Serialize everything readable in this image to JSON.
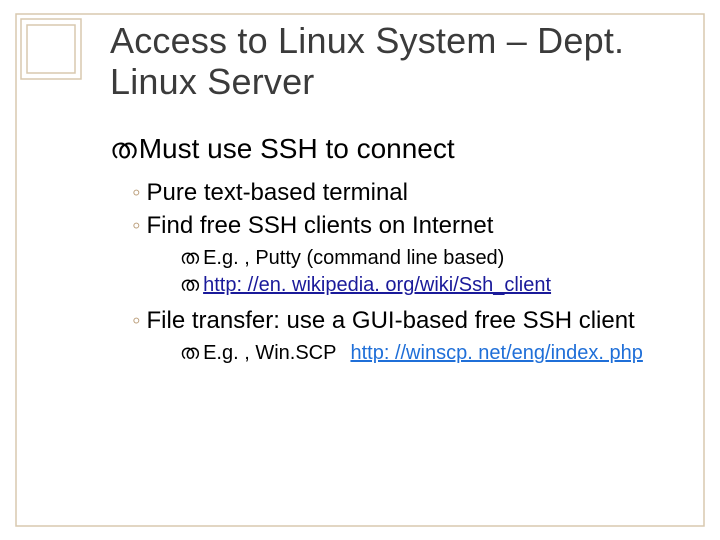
{
  "title": "Access to Linux System – Dept. Linux Server",
  "main": {
    "text": "Must use SSH to connect"
  },
  "sub": {
    "s1": "Pure text-based terminal",
    "s2": "Find free SSH clients on Internet",
    "s2a": "E.g. , Putty  (command line based)",
    "s2b": "http: //en. wikipedia. org/wiki/Ssh_client",
    "s3": "File transfer: use a GUI-based free SSH client",
    "s3a_prefix": "E.g. , Win.SCP",
    "s3a_link": "http: //winscp. net/eng/index. php"
  },
  "glyph": {
    "flourish": "ത",
    "ring": "◦"
  }
}
